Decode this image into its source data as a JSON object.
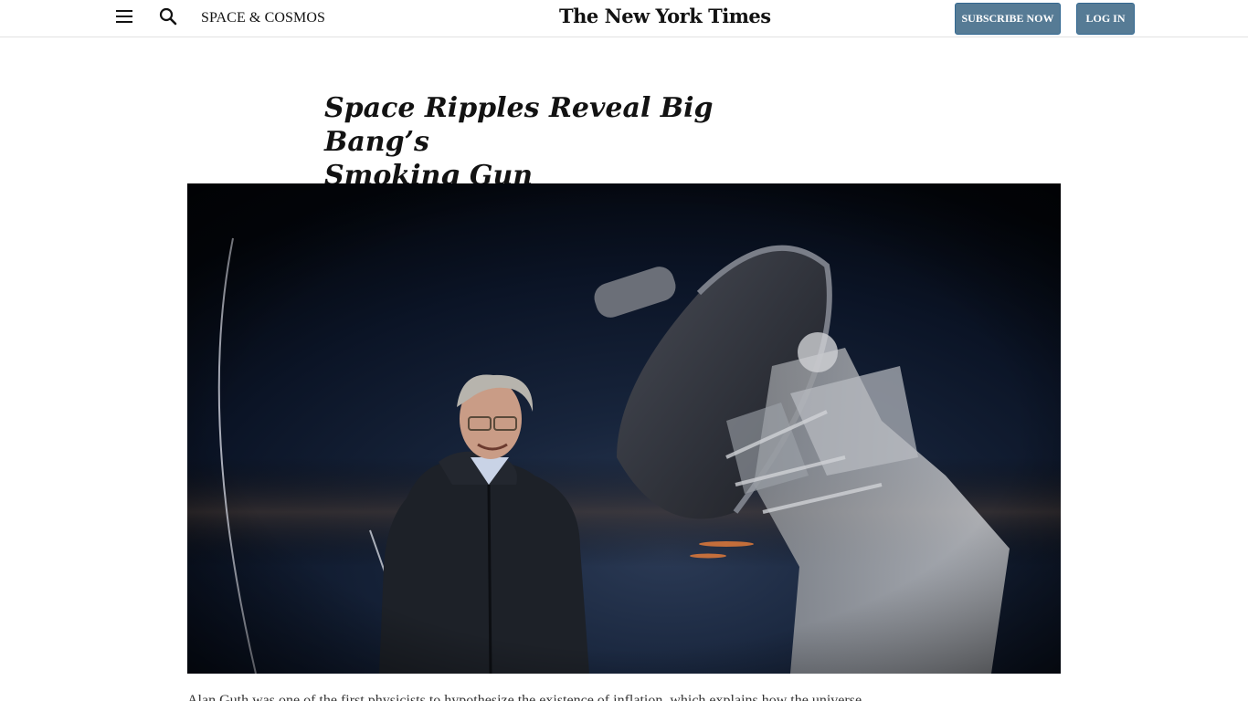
{
  "header": {
    "section": "SPACE & COSMOS",
    "logo": "The New York Times",
    "subscribe_label": "SUBSCRIBE NOW",
    "login_label": "LOG IN"
  },
  "icons": {
    "menu": "menu-icon",
    "search": "search-icon"
  },
  "colors": {
    "button_bg": "#567b95",
    "divider": "#e2e2e2"
  },
  "article": {
    "headline_line1": "Space Ripples Reveal Big Bang’s",
    "headline_line2": "Smoking Gun",
    "caption": "Alan Guth was one of the first physicists to hypothesize the existence of inflation, which explains how the universe"
  }
}
